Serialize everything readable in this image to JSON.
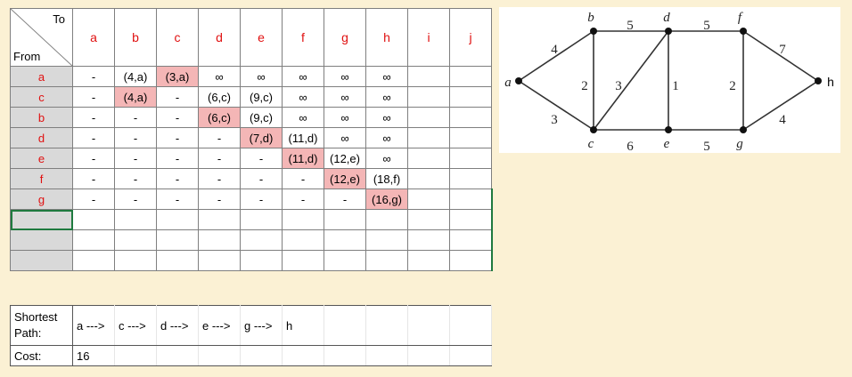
{
  "table": {
    "to_label": "To",
    "from_label": "From",
    "columns": [
      "a",
      "b",
      "c",
      "d",
      "e",
      "f",
      "g",
      "h",
      "i",
      "j"
    ],
    "rows": [
      {
        "from": "a",
        "cells": [
          "-",
          "(4,a)",
          "(3,a)",
          "∞",
          "∞",
          "∞",
          "∞",
          "∞",
          "",
          ""
        ],
        "highlight": [
          2
        ]
      },
      {
        "from": "c",
        "cells": [
          "-",
          "(4,a)",
          "-",
          "(6,c)",
          "(9,c)",
          "∞",
          "∞",
          "∞",
          "",
          ""
        ],
        "highlight": [
          1
        ]
      },
      {
        "from": "b",
        "cells": [
          "-",
          "-",
          "-",
          "(6,c)",
          "(9,c)",
          "∞",
          "∞",
          "∞",
          "",
          ""
        ],
        "highlight": [
          3
        ]
      },
      {
        "from": "d",
        "cells": [
          "-",
          "-",
          "-",
          "-",
          "(7,d)",
          "(11,d)",
          "∞",
          "∞",
          "",
          ""
        ],
        "highlight": [
          4
        ]
      },
      {
        "from": "e",
        "cells": [
          "-",
          "-",
          "-",
          "-",
          "-",
          "(11,d)",
          "(12,e)",
          "∞",
          "",
          ""
        ],
        "highlight": [
          5
        ]
      },
      {
        "from": "f",
        "cells": [
          "-",
          "-",
          "-",
          "-",
          "-",
          "-",
          "(12,e)",
          "(18,f)",
          "",
          ""
        ],
        "highlight": [
          6
        ]
      },
      {
        "from": "g",
        "cells": [
          "-",
          "-",
          "-",
          "-",
          "-",
          "-",
          "-",
          "(16,g)",
          "",
          ""
        ],
        "highlight": [
          7
        ]
      },
      {
        "from": "",
        "cells": [
          "",
          "",
          "",
          "",
          "",
          "",
          "",
          "",
          "",
          ""
        ],
        "highlight": []
      },
      {
        "from": "",
        "cells": [
          "",
          "",
          "",
          "",
          "",
          "",
          "",
          "",
          "",
          ""
        ],
        "highlight": []
      },
      {
        "from": "",
        "cells": [
          "",
          "",
          "",
          "",
          "",
          "",
          "",
          "",
          "",
          ""
        ],
        "highlight": []
      }
    ]
  },
  "result": {
    "shortest_label_line1": "Shortest",
    "shortest_label_line2": "Path:",
    "path_steps": [
      "a --->",
      "c --->",
      "d --->",
      "e --->",
      "g --->",
      "h"
    ],
    "cost_label": "Cost:",
    "cost_value": "16"
  },
  "graph": {
    "vertices": [
      "a",
      "b",
      "c",
      "d",
      "e",
      "f",
      "g",
      "h"
    ],
    "edges": [
      {
        "from": "a",
        "to": "b",
        "weight": "4"
      },
      {
        "from": "a",
        "to": "c",
        "weight": "3"
      },
      {
        "from": "b",
        "to": "c",
        "weight": "2"
      },
      {
        "from": "b",
        "to": "d",
        "weight": "5"
      },
      {
        "from": "c",
        "to": "d",
        "weight": "3"
      },
      {
        "from": "c",
        "to": "e",
        "weight": "6"
      },
      {
        "from": "d",
        "to": "e",
        "weight": "1"
      },
      {
        "from": "d",
        "to": "f",
        "weight": "5"
      },
      {
        "from": "e",
        "to": "g",
        "weight": "5"
      },
      {
        "from": "f",
        "to": "g",
        "weight": "2"
      },
      {
        "from": "f",
        "to": "h",
        "weight": "7"
      },
      {
        "from": "g",
        "to": "h",
        "weight": "4"
      }
    ]
  },
  "colors": {
    "background": "#fbf1d4",
    "header_text": "#e01010",
    "highlight": "#f4b6b6",
    "row_header_bg": "#d9d9d9",
    "selection": "#1f7a3f"
  }
}
